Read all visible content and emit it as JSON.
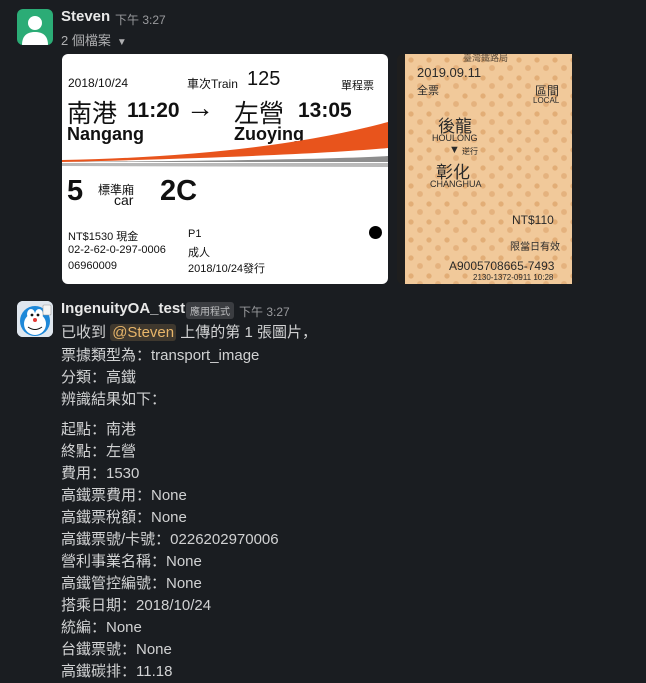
{
  "message1": {
    "sender": "Steven",
    "time": "下午 3:27",
    "files_label": "2 個檔案",
    "hsr_ticket": {
      "date": "2018/10/24",
      "train_label": "車次Train",
      "train_no": "125",
      "ticket_type": "單程票",
      "from_zh": "南港",
      "depart_time": "11:20",
      "arrow": "→",
      "to_zh": "左營",
      "arrive_time": "13:05",
      "from_en": "Nangang",
      "to_en": "Zuoying",
      "car_no": "5",
      "car_class": "標準廂",
      "car_en": "car",
      "seat": "2C",
      "price_line": "NT$1530  現金",
      "p_code": "P1",
      "ticket_no": "02-2-62-0-297-0006",
      "passenger": "成人",
      "serial": "06960009",
      "issued": "2018/10/24發行",
      "stripe_orange": "#e8541c",
      "stripe_gray": "#8d8d8d"
    },
    "tra_ticket": {
      "top_label": "臺灣鐵路局",
      "date": "2019.09.11",
      "fare_type": "全票",
      "zone_zh": "區間",
      "zone_en": "LOCAL",
      "from_zh": "後龍",
      "from_en": "HOULONG",
      "direction": "逆行",
      "to_zh": "彰化",
      "to_en": "CHANGHUA",
      "price": "NT$110",
      "validity": "限當日有效",
      "serial": "A9005708665-7493",
      "code": "2130-1372-0911 10:28"
    }
  },
  "message2": {
    "sender": "IngenuityOA_test",
    "badge": "應用程式",
    "time": "下午 3:27",
    "intro_prefix": "已收到",
    "mention": "@Steven",
    "intro_suffix": "上傳的第 1 張圖片，",
    "lines_top": [
      "票據類型為：transport_image",
      "分類：高鐵",
      "辨識結果如下："
    ],
    "result_lines": [
      "起點：南港",
      "終點：左營",
      "費用：1530",
      "高鐵票費用：None",
      "高鐵票稅額：None",
      "高鐵票號/卡號：0226202970006",
      "營利事業名稱：None",
      "高鐵管控編號：None",
      "搭乘日期：2018/10/24",
      "統編：None",
      "台鐵票號：None",
      "高鐵碳排：11.18"
    ]
  }
}
